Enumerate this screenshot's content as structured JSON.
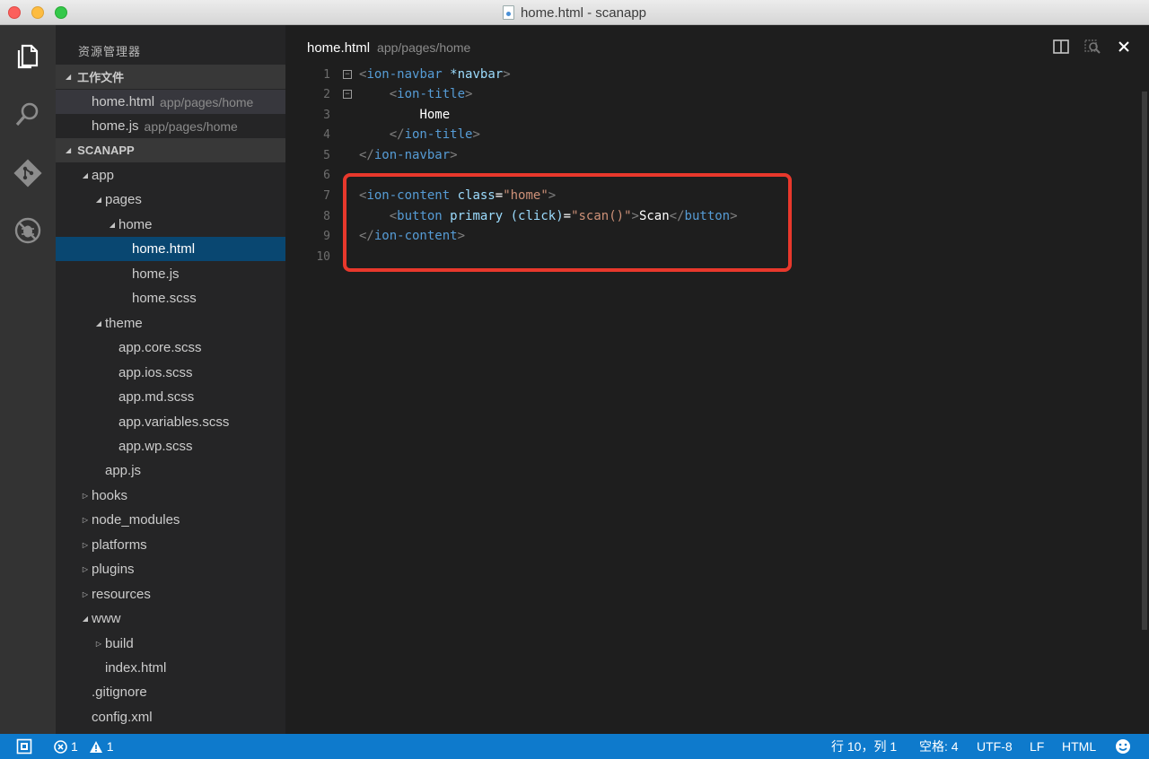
{
  "window": {
    "title": "home.html - scanapp"
  },
  "activity": {
    "icons": [
      "files-icon",
      "search-icon",
      "git-icon",
      "debug-icon"
    ]
  },
  "sidebar": {
    "title": "资源管理器",
    "working_files_label": "工作文件",
    "working_files": [
      {
        "name": "home.html",
        "path": "app/pages/home"
      },
      {
        "name": "home.js",
        "path": "app/pages/home"
      }
    ],
    "project_label": "SCANAPP",
    "tree": [
      {
        "label": "app",
        "level": 1,
        "expanded": true
      },
      {
        "label": "pages",
        "level": 2,
        "expanded": true
      },
      {
        "label": "home",
        "level": 3,
        "expanded": true
      },
      {
        "label": "home.html",
        "level": 4,
        "file": true
      },
      {
        "label": "home.js",
        "level": 4,
        "file": true
      },
      {
        "label": "home.scss",
        "level": 4,
        "file": true
      },
      {
        "label": "theme",
        "level": 2,
        "expanded": true
      },
      {
        "label": "app.core.scss",
        "level": 3,
        "file": true
      },
      {
        "label": "app.ios.scss",
        "level": 3,
        "file": true
      },
      {
        "label": "app.md.scss",
        "level": 3,
        "file": true
      },
      {
        "label": "app.variables.scss",
        "level": 3,
        "file": true
      },
      {
        "label": "app.wp.scss",
        "level": 3,
        "file": true
      },
      {
        "label": "app.js",
        "level": 2,
        "file": true
      },
      {
        "label": "hooks",
        "level": 1,
        "expanded": false
      },
      {
        "label": "node_modules",
        "level": 1,
        "expanded": false
      },
      {
        "label": "platforms",
        "level": 1,
        "expanded": false
      },
      {
        "label": "plugins",
        "level": 1,
        "expanded": false
      },
      {
        "label": "resources",
        "level": 1,
        "expanded": false
      },
      {
        "label": "www",
        "level": 1,
        "expanded": true
      },
      {
        "label": "build",
        "level": 2,
        "expanded": false
      },
      {
        "label": "index.html",
        "level": 2,
        "file": true
      },
      {
        "label": ".gitignore",
        "level": 1,
        "file": true
      },
      {
        "label": "config.xml",
        "level": 1,
        "file": true
      }
    ]
  },
  "editor": {
    "tab_name": "home.html",
    "tab_path": "app/pages/home",
    "line_numbers": [
      "1",
      "2",
      "3",
      "4",
      "5",
      "6",
      "7",
      "8",
      "9",
      "10"
    ]
  },
  "status": {
    "errors": "1",
    "warnings": "1",
    "position": "行 10，列 1",
    "indent": "空格: 4",
    "encoding": "UTF-8",
    "eol": "LF",
    "language": "HTML"
  },
  "colors": {
    "status_bar": "#0e7acc",
    "highlight_border": "#e8382c",
    "selection": "#094771"
  }
}
